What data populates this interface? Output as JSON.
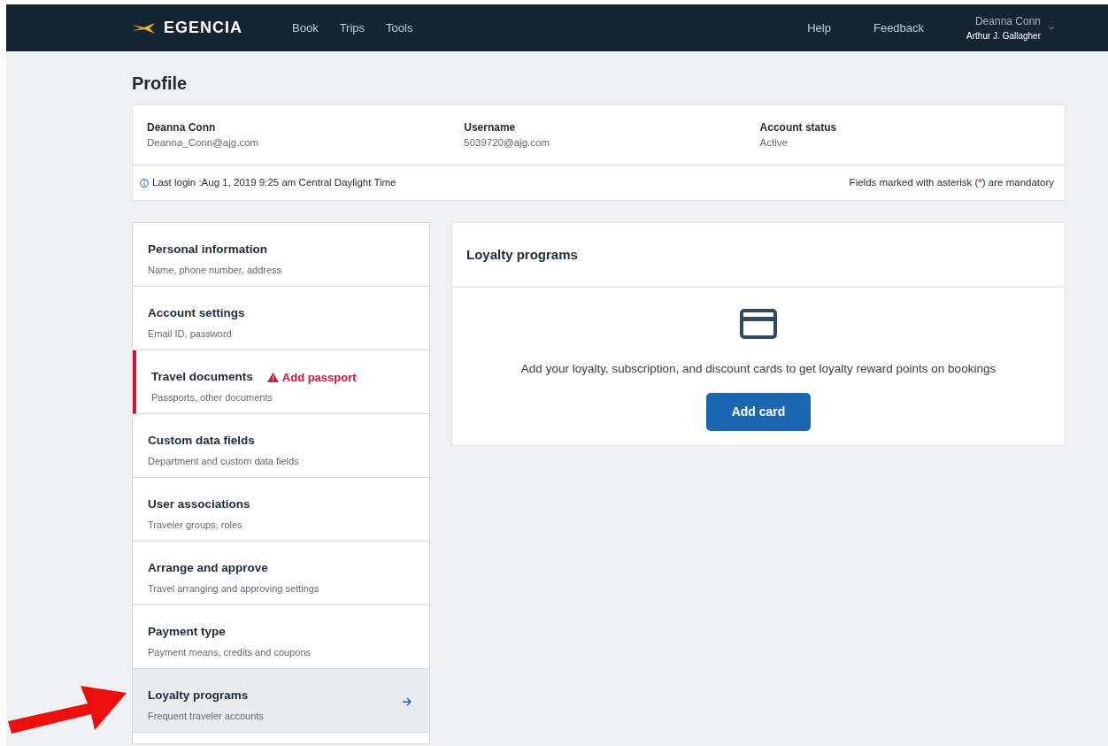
{
  "navbar": {
    "logo": "EGENCIA",
    "links": [
      "Book",
      "Trips",
      "Tools"
    ],
    "right_links": [
      "Help",
      "Feedback"
    ],
    "user": {
      "name": "Deanna Conn",
      "company": "Arthur J. Gallagher"
    }
  },
  "page_title": "Profile",
  "summary": {
    "fields": [
      {
        "label": "Deanna Conn",
        "value": "Deanna_Conn@ajg.com"
      },
      {
        "label": "Username",
        "value": "5039720@ajg.com"
      },
      {
        "label": "Account status",
        "value": "Active"
      }
    ],
    "last_login": "Last login :Aug 1, 2019 9:25 am Central Daylight Time",
    "mandatory_note": {
      "before": "Fields marked with asterisk (",
      "mark": "*",
      "after": ") are mandatory"
    }
  },
  "sidebar": {
    "items": [
      {
        "title": "Personal information",
        "subtitle": "Name, phone number, address",
        "selected": false
      },
      {
        "title": "Account settings",
        "subtitle": "Email ID, password",
        "selected": false
      },
      {
        "title": "Travel documents",
        "subtitle": "Passports, other documents",
        "selected": false,
        "alert": "Add passport"
      },
      {
        "title": "Custom data fields",
        "subtitle": "Department and custom data fields",
        "selected": false
      },
      {
        "title": "User associations",
        "subtitle": "Traveler groups, roles",
        "selected": false
      },
      {
        "title": "Arrange and approve",
        "subtitle": "Travel arranging and approving settings",
        "selected": false
      },
      {
        "title": "Payment type",
        "subtitle": "Payment means, credits and coupons",
        "selected": false
      },
      {
        "title": "Loyalty programs",
        "subtitle": "Frequent traveler accounts",
        "selected": true
      }
    ]
  },
  "panel": {
    "title": "Loyalty programs",
    "message": "Add your loyalty, subscription, and discount cards to get loyalty reward points on bookings",
    "button": "Add card"
  }
}
